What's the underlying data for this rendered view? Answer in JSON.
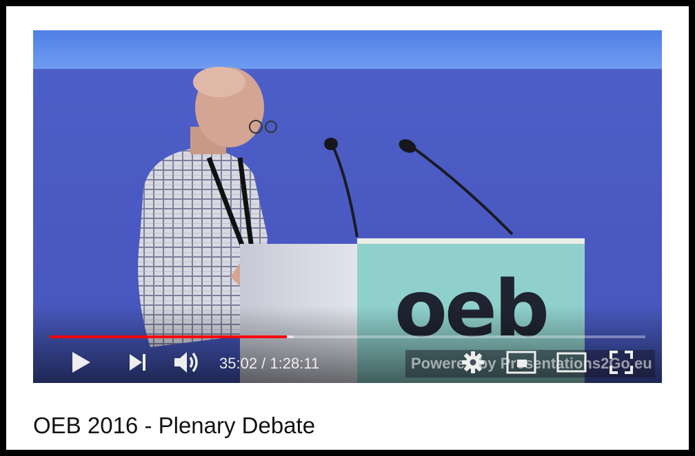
{
  "video": {
    "played_fraction": 0.3976,
    "buffered_fraction": 0.41,
    "current_time": "35:02",
    "separator": " / ",
    "duration": "1:28:11",
    "podium_logo_text": "oeb",
    "watermark_text": "Powered by Presentations2Go.eu"
  },
  "controls": {
    "play": "play-icon",
    "next": "next-icon",
    "volume": "volume-icon",
    "settings": "gear-icon",
    "miniplayer": "miniplayer-icon",
    "theater": "theater-mode-icon",
    "fullscreen": "fullscreen-icon"
  },
  "colors": {
    "progress_played": "#ff0000",
    "page_background": "#ffffff",
    "outer_border": "#000000"
  },
  "page": {
    "title": "OEB 2016 - Plenary Debate"
  }
}
